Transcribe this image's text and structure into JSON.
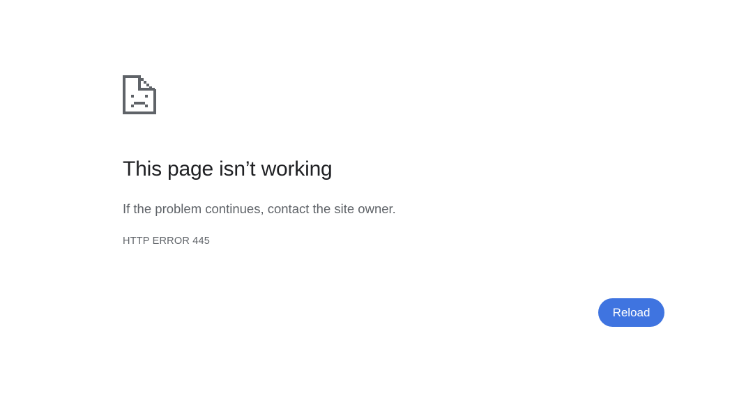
{
  "error_page": {
    "icon": "sad-document-icon",
    "title": "This page isn’t working",
    "message": "If the problem continues, contact the site owner.",
    "error_code": "HTTP ERROR 445",
    "reload_label": "Reload"
  },
  "colors": {
    "title": "#202124",
    "secondary_text": "#5f6368",
    "icon": "#5f6368",
    "button_background": "#3f74e0",
    "button_text": "#ffffff",
    "background": "#ffffff"
  }
}
